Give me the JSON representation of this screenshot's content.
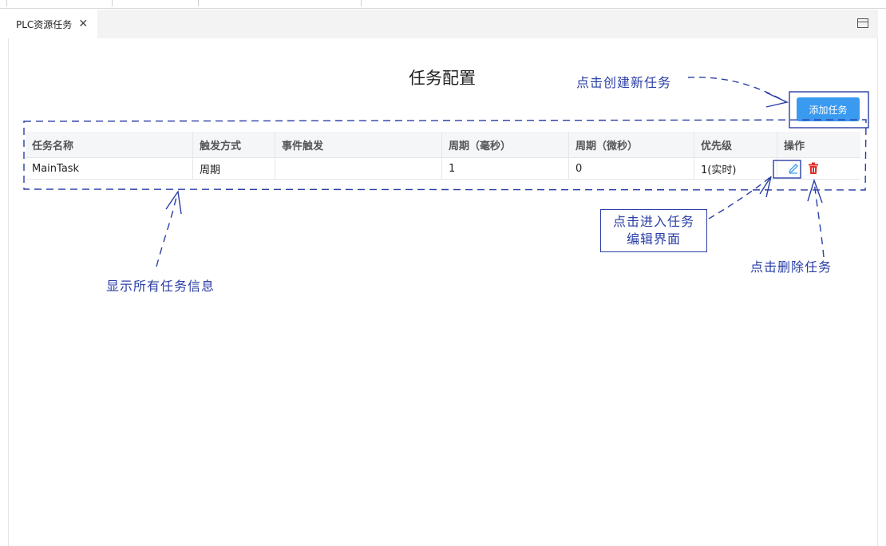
{
  "tab": {
    "label": "PLC资源任务",
    "close_glyph": "✕",
    "maximize_icon": "maximize-icon"
  },
  "page": {
    "title": "任务配置",
    "add_button": "添加任务"
  },
  "table": {
    "columns": [
      "任务名称",
      "触发方式",
      "事件触发",
      "周期（毫秒）",
      "周期（微秒）",
      "优先级",
      "操作"
    ],
    "rows": [
      {
        "name": "MainTask",
        "trigger": "周期",
        "event": "",
        "period_ms": "1",
        "period_us": "0",
        "priority": "1(实时)"
      }
    ]
  },
  "annotations": {
    "add_hint": "点击创建新任务",
    "table_hint": "显示所有任务信息",
    "edit_hint_line1": "点击进入任务",
    "edit_hint_line2": "编辑界面",
    "delete_hint": "点击删除任务"
  },
  "colors": {
    "accent": "#3a9af0",
    "annotation": "#2a3ea6",
    "delete": "#e0302a"
  }
}
